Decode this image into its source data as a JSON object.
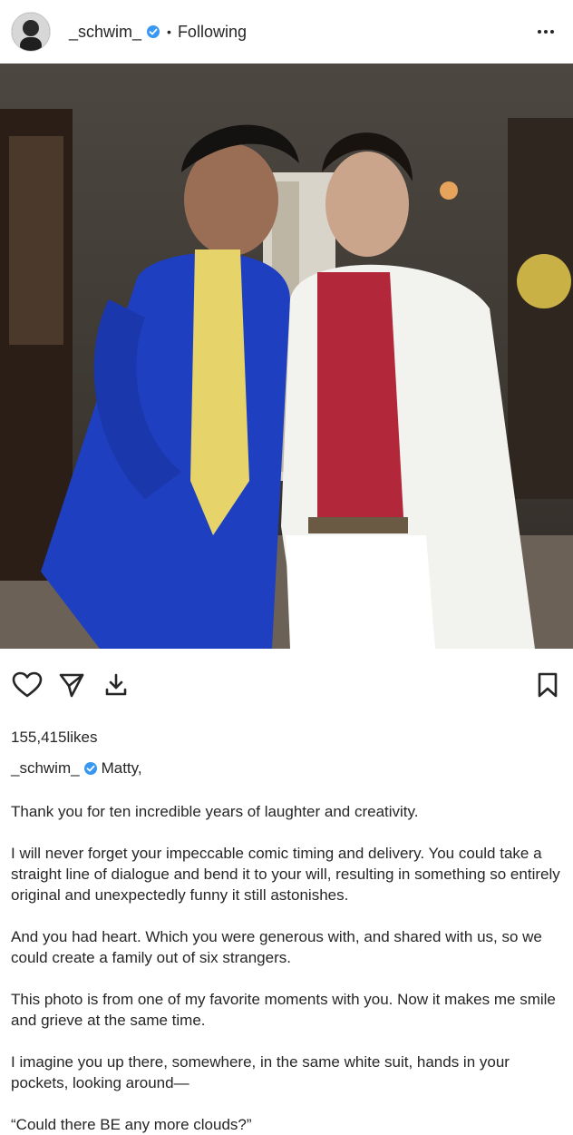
{
  "header": {
    "username": "_schwim_",
    "separator": "•",
    "following": "Following"
  },
  "icons": {
    "avatar": "profile-avatar",
    "verified": "verified-badge-icon",
    "more": "more-options-icon",
    "like": "heart-icon",
    "share": "send-icon",
    "download": "download-icon",
    "save": "bookmark-icon"
  },
  "colors": {
    "verified_blue": "#3897f0",
    "text": "#262626"
  },
  "post": {
    "likes_count": "155,415",
    "likes_suffix": "likes",
    "caption_user": "_schwim_",
    "caption_first": "Matty,",
    "paragraphs": [
      "Thank you for ten incredible years of laughter and creativity.",
      "I will never forget your impeccable comic timing and delivery. You could take a straight line of dialogue and bend it to your will, resulting in something so entirely original and unexpectedly funny it still astonishes.",
      "And you had heart. Which you were generous with, and shared with us, so we could create a family out of six strangers.",
      "This photo is from one of my favorite moments with you. Now it makes me smile and grieve at the same time.",
      "I imagine you up there, somewhere, in the same white suit, hands in your pockets, looking around—",
      "“Could there BE any more clouds?”"
    ]
  }
}
